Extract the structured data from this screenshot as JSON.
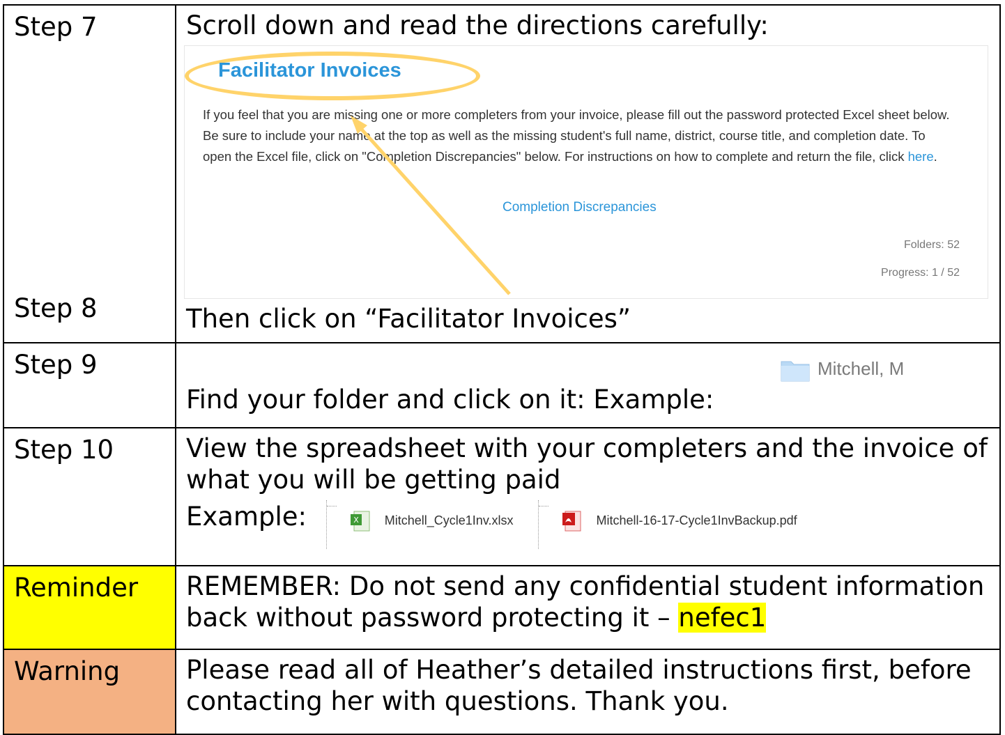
{
  "rows": [
    {
      "label": "Step 7",
      "text": "Scroll down and read the directions carefully:",
      "screenshot": {
        "title": "Facilitator Invoices",
        "description": "If you feel that you are missing one or more completers from your invoice, please fill out the password protected Excel sheet below.  Be sure to include your name at the top as well as the missing student's full name, district, course title, and completion date.  To open the Excel file, click on \"Completion Discrepancies\" below.  For instructions on how to complete and return the file, click",
        "here_link": "here",
        "period": ".",
        "link": "Completion Discrepancies",
        "folders": "Folders: 52",
        "progress": "Progress: 1 / 52"
      }
    },
    {
      "label": "Step 8",
      "text": "Then click on “Facilitator Invoices”"
    },
    {
      "label": "Step 9",
      "text": "Find your folder and click on it:  Example:",
      "folder_example": "Mitchell, M"
    },
    {
      "label": "Step 10",
      "text": "View the spreadsheet with your completers and the invoice of what you will be getting paid",
      "example_label": "Example:",
      "files": [
        {
          "name": "Mitchell_Cycle1Inv.xlsx",
          "icon": "excel-file-icon"
        },
        {
          "name": "Mitchell-16-17-Cycle1InvBackup.pdf",
          "icon": "pdf-file-icon"
        }
      ]
    },
    {
      "label": "Reminder",
      "text": "REMEMBER:  Do not send any confidential student information back without password protecting it –",
      "password": "nefec1"
    },
    {
      "label": "Warning",
      "text": "Please read all of Heather’s detailed instructions first, before contacting her with questions.  Thank you."
    }
  ],
  "colors": {
    "reminder_bg": "#ffff00",
    "warning_bg": "#f4b183",
    "link_blue": "#2b95d9",
    "oval": "#ffd36a"
  }
}
